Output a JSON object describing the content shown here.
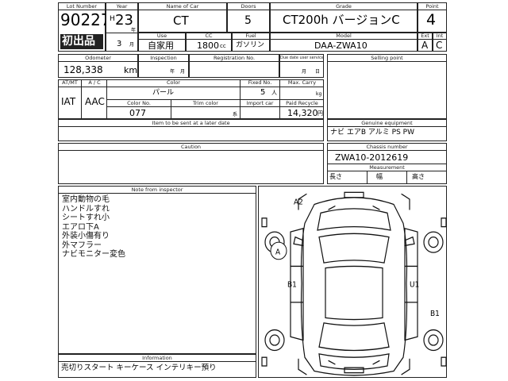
{
  "header": {
    "lot_no_label": "Lot Number",
    "lot_no": "90227",
    "badge": "初出品",
    "year_label": "Year",
    "year_era": "H",
    "year_value": "23",
    "year_unit": "年",
    "month_value": "3",
    "month_unit": "月",
    "car_name_label": "Name of Car",
    "car_name": "CT",
    "doors_label": "Doors",
    "doors": "5",
    "grade_label": "Grade",
    "grade": "CT200h バージョンC",
    "point_label": "Point",
    "point": "4",
    "use_label": "Use",
    "use": "自家用",
    "cc_label": "CC",
    "cc_value": "1800",
    "cc_unit": "cc",
    "fuel_label": "Fuel",
    "fuel": "ガソリン",
    "model_label": "Model",
    "model": "DAA-ZWA10",
    "ext_label": "Ext",
    "ext": "A",
    "int_label": "Int",
    "int": "C"
  },
  "row2": {
    "odometer_label": "Odometer",
    "odometer": "128,338",
    "odometer_unit": "km",
    "inspection_label": "Inspection",
    "inspection_year": "年",
    "inspection_month": "月",
    "registration_label": "Registration No.",
    "due_date_label": "Due date user service",
    "due_month": "月",
    "due_day": "日",
    "selling_point_label": "Selling point"
  },
  "row3": {
    "atmt_label": "AT/MT",
    "ac_label": "A / C",
    "atmt": "IAT",
    "ac": "AAC",
    "color_label": "Color",
    "color": "パール",
    "fixed_no_label": "Fixed No.",
    "fixed_no": "5",
    "fixed_no_unit": "人",
    "max_carry_label": "Max. Carry",
    "max_carry_unit": "kg",
    "color_no_label": "Color No.",
    "color_no": "077",
    "trim_color_label": "Trim color",
    "trim_unit": "系",
    "import_car_label": "Import car",
    "paid_recycle_label": "Paid Recycle",
    "paid_recycle": "14,320",
    "paid_recycle_unit": "円"
  },
  "row4": {
    "items_label": "Item to be sent at a later date",
    "genuine_label": "Genuine equipment",
    "genuine": "ナビ エアB アルミ PS PW"
  },
  "row5": {
    "caution_label": "Caution",
    "chassis_label": "Chassis number",
    "chassis": "ZWA10-2012619",
    "measurement_label": "Measurement",
    "length_label": "長さ",
    "width_label": "幅",
    "height_label": "高さ"
  },
  "notes": {
    "label": "Note from inspector",
    "lines": [
      "室内動物の毛",
      "ハンドルすれ",
      "シートすれ小",
      "エアロ下A",
      "外装小傷有り",
      "外マフラー",
      "ナビモニター変色"
    ]
  },
  "information": {
    "label": "Information",
    "text": "売切りスタート キーケース インテリキー預り"
  },
  "diagram": {
    "marks": [
      "A2",
      "A",
      "B1",
      "U1",
      "B1"
    ]
  }
}
